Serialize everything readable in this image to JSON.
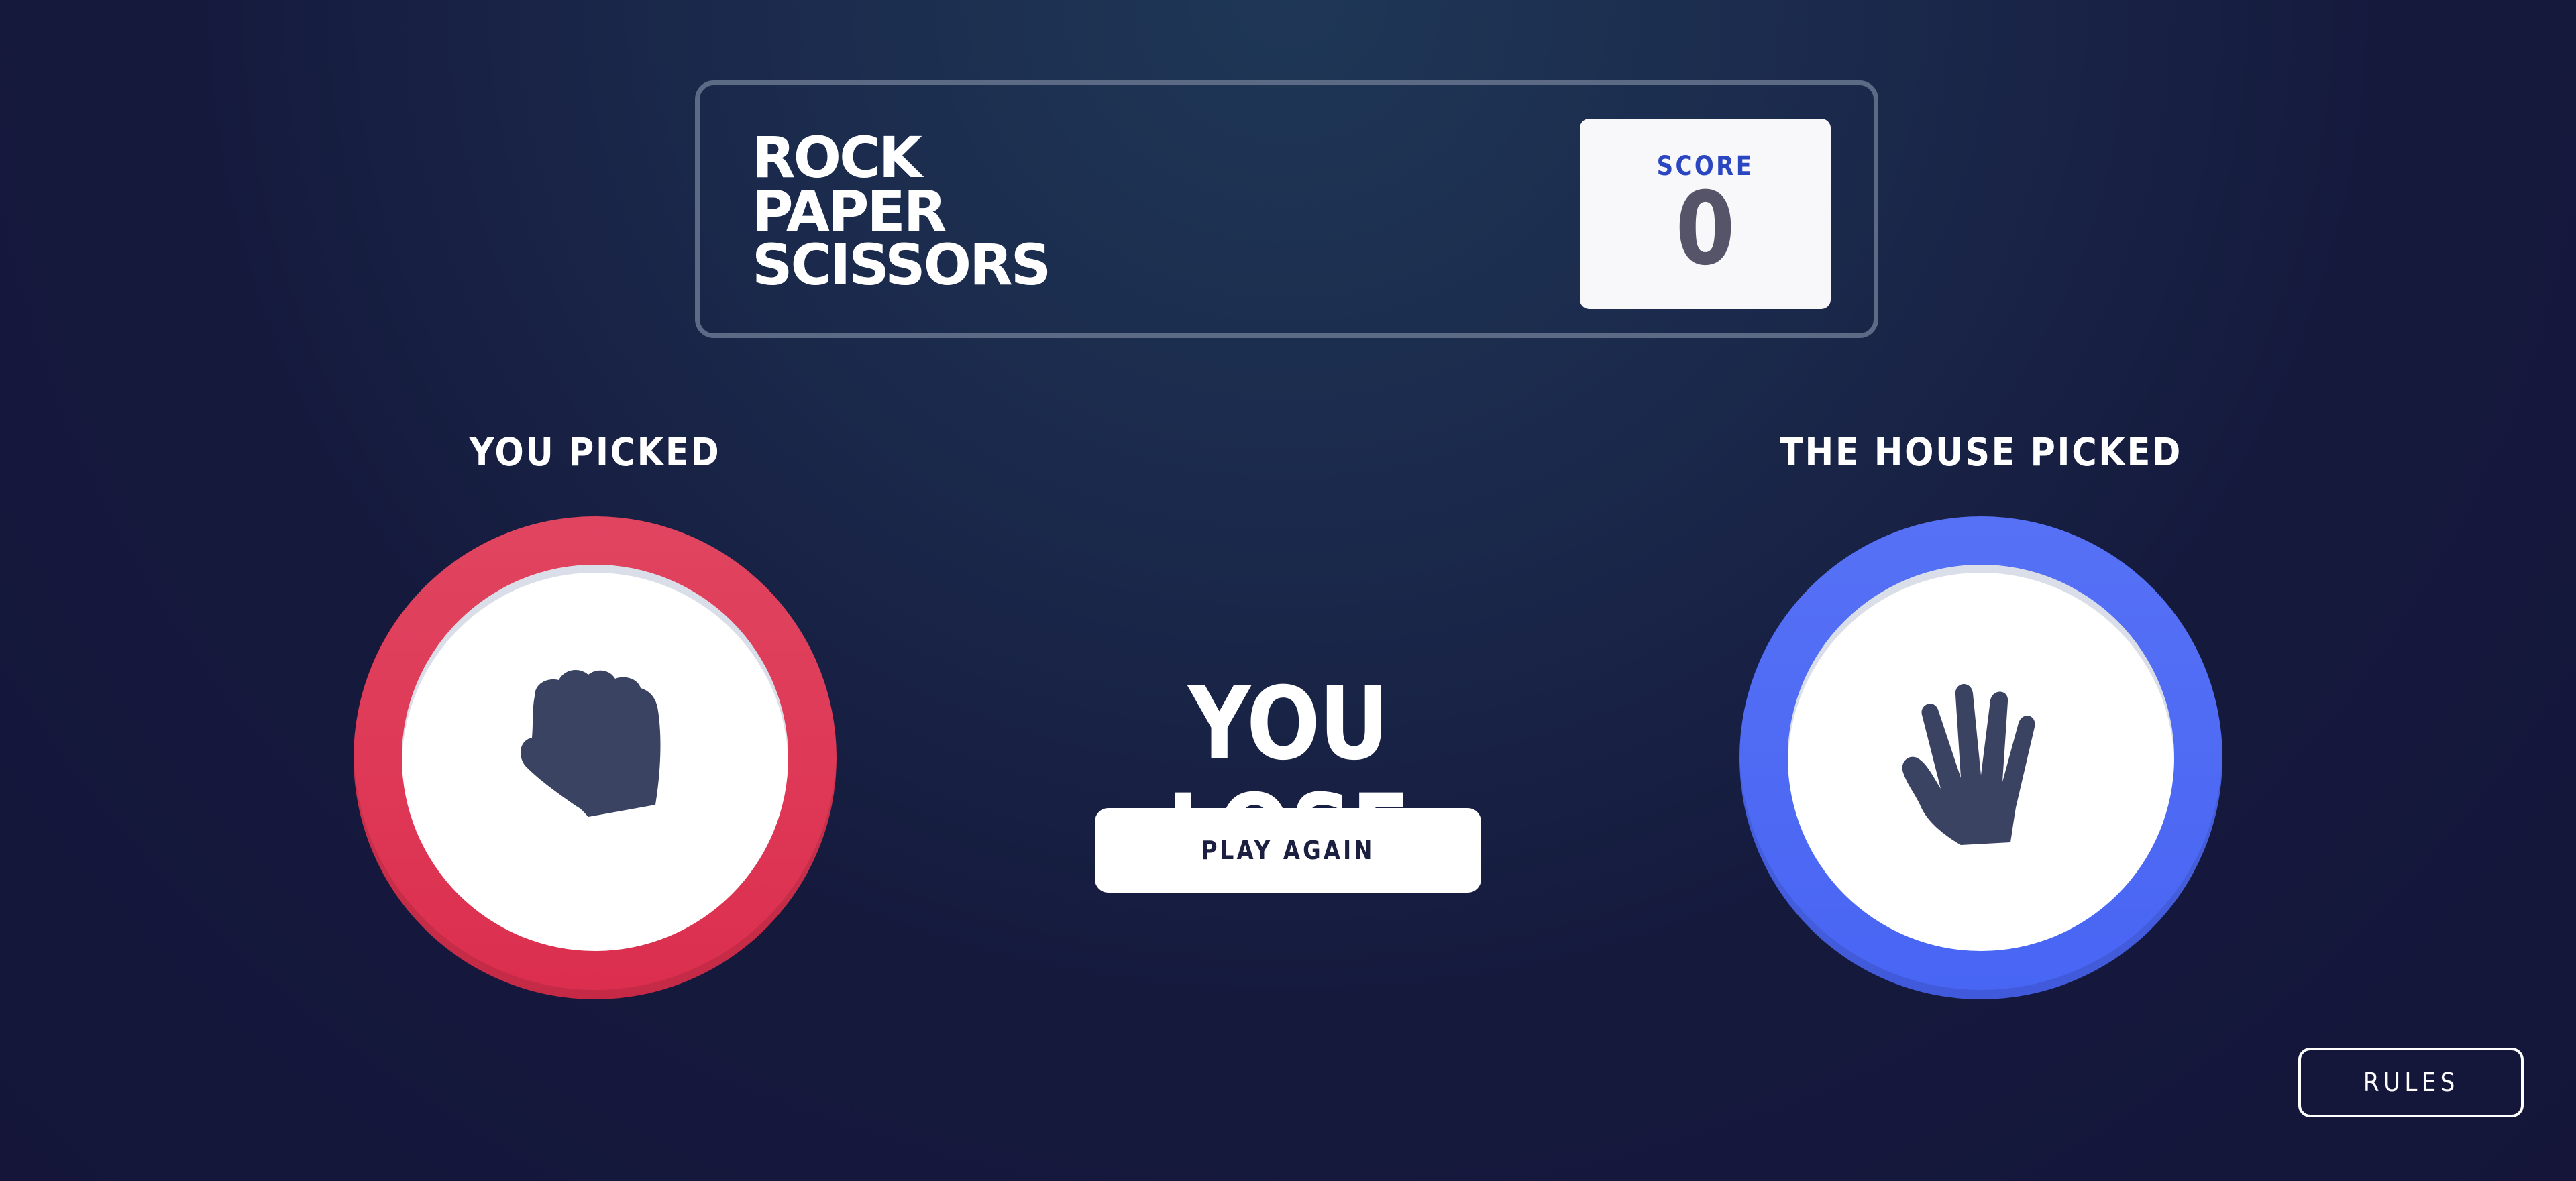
{
  "header": {
    "title_lines": [
      "ROCK",
      "PAPER",
      "SCISSORS"
    ],
    "score_label": "SCORE",
    "score_value": "0"
  },
  "player": {
    "label": "YOU PICKED",
    "choice": "rock",
    "icon": "rock-hand-icon",
    "ring_color": "#dc2e4e"
  },
  "house": {
    "label": "THE HOUSE PICKED",
    "choice": "paper",
    "icon": "paper-hand-icon",
    "ring_color": "#4865f4"
  },
  "result": {
    "text": "YOU LOSE",
    "play_again_label": "PLAY AGAIN"
  },
  "rules_label": "RULES",
  "colors": {
    "background_dark": "#141539",
    "background_light": "#1f3756",
    "header_outline": "#5c6a86",
    "score_text": "#2a46c0",
    "dark_text": "#3b4363"
  }
}
